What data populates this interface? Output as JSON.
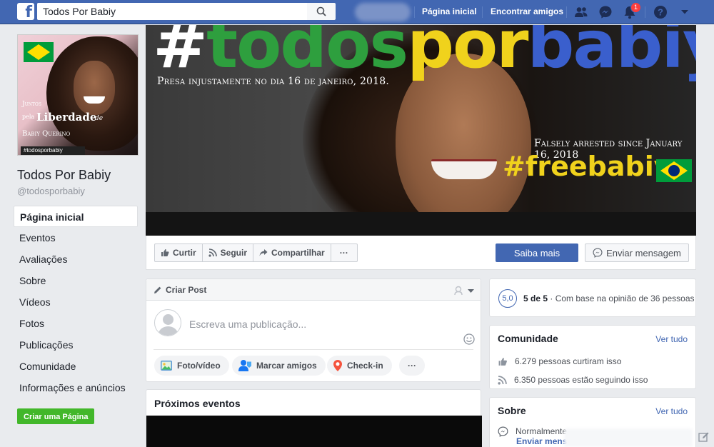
{
  "topbar": {
    "logo": "f",
    "search_value": "Todos Por Babiy",
    "nav": {
      "home": "Página inicial",
      "find_friends": "Encontrar amigos"
    },
    "notification_count": "1",
    "icons": [
      "search-icon",
      "friends-icon",
      "messenger-icon",
      "notifications-icon",
      "help-icon",
      "dropdown-arrow-icon"
    ]
  },
  "page": {
    "name": "Todos Por Babiy",
    "handle": "@todosporbabiy",
    "left_nav": [
      "Página inicial",
      "Eventos",
      "Avaliações",
      "Sobre",
      "Vídeos",
      "Fotos",
      "Publicações",
      "Comunidade",
      "Informações e anúncios"
    ],
    "create_page_label": "Criar uma Página"
  },
  "profile_picture": {
    "line1": "Juntos",
    "line2": "pela",
    "line3": "Liberdade",
    "line4": "de",
    "line5": "Babiy Querino",
    "tag": "#todosporbabiy"
  },
  "cover": {
    "hashtag_parts": [
      {
        "text": "#",
        "color": "#ffffff"
      },
      {
        "text": "todos",
        "color": "#2e9f3e"
      },
      {
        "text": "por",
        "color": "#f0d21c"
      },
      {
        "text": "babiy",
        "color": "#3a5fcd"
      }
    ],
    "subtitle_pt": "Presa injustamente no dia 16 de janeiro, 2018.",
    "subtitle_en": "Falsely arrested since January 16, 2018",
    "freehashtag": "#freebabiy"
  },
  "actions": {
    "like": "Curtir",
    "follow": "Seguir",
    "share": "Compartilhar",
    "more": "···",
    "learn_more": "Saiba mais",
    "send_message": "Enviar mensagem"
  },
  "create_post": {
    "title": "Criar Post",
    "placeholder": "Escreva uma publicação...",
    "photo_video": "Foto/vídeo",
    "tag_friends": "Marcar amigos",
    "check_in": "Check-in",
    "more": "···"
  },
  "events": {
    "title": "Próximos eventos"
  },
  "rating": {
    "score": "5,0",
    "out_of": "5 de 5",
    "based_on": " · Com base na opinião de 36 pessoas"
  },
  "community": {
    "title": "Comunidade",
    "see_all": "Ver tudo",
    "likes": "6.279 pessoas curtiram isso",
    "follows": "6.350 pessoas estão seguindo isso"
  },
  "about": {
    "title": "Sobre",
    "see_all": "Ver tudo",
    "response": "Normalmente",
    "send_message_link": "Enviar mens"
  },
  "colors": {
    "brand": "#4267b2",
    "background": "#e9ebee",
    "green_button": "#42b72a"
  }
}
